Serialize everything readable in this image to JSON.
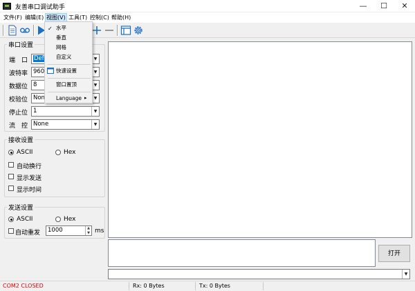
{
  "window": {
    "title": "友善串口调试助手",
    "minimize_glyph": "—",
    "maximize_glyph": "☐",
    "close_glyph": "✕"
  },
  "menubar": {
    "items": [
      "文件(F)",
      "编辑(E)",
      "视图(V)",
      "工具(T)",
      "控制(C)",
      "帮助(H)"
    ],
    "active_index": 2
  },
  "view_menu": {
    "items": [
      "水平",
      "垂直",
      "网格",
      "自定义",
      "快速设置",
      "窗口置顶",
      "Language"
    ],
    "checked": "水平",
    "submenu_arrow": "▸"
  },
  "toolbar": {
    "icons": [
      "new-document-icon",
      "record-icon",
      "play-icon",
      "add-icon",
      "minus-icon",
      "window-icon",
      "gear-icon"
    ]
  },
  "serial_settings": {
    "title": "串口设置",
    "rows": [
      {
        "label": "端　口",
        "value": "Def"
      },
      {
        "label": "波特率",
        "value": "960"
      },
      {
        "label": "数据位",
        "value": "8"
      },
      {
        "label": "校验位",
        "value": "Non"
      },
      {
        "label": "停止位",
        "value": "1"
      },
      {
        "label": "流　控",
        "value": "None"
      }
    ]
  },
  "receive_settings": {
    "title": "接收设置",
    "radio_ascii": "ASCII",
    "radio_hex": "Hex",
    "selected": "ASCII",
    "checkboxes": [
      "自动换行",
      "显示发送",
      "显示时间"
    ]
  },
  "send_settings": {
    "title": "发送设置",
    "radio_ascii": "ASCII",
    "radio_hex": "Hex",
    "selected": "ASCII",
    "auto_resend_label": "自动重发",
    "interval_value": "1000",
    "interval_unit": "ms"
  },
  "send_area": {
    "open_button": "打开",
    "history_value": ""
  },
  "statusbar": {
    "port_status": "COM2 CLOSED",
    "rx": "Rx: 0 Bytes",
    "tx": "Tx: 0 Bytes"
  },
  "colors": {
    "status_closed": "#e00000",
    "selection": "#0078d7",
    "accent_blue": "#1b6ec2"
  }
}
